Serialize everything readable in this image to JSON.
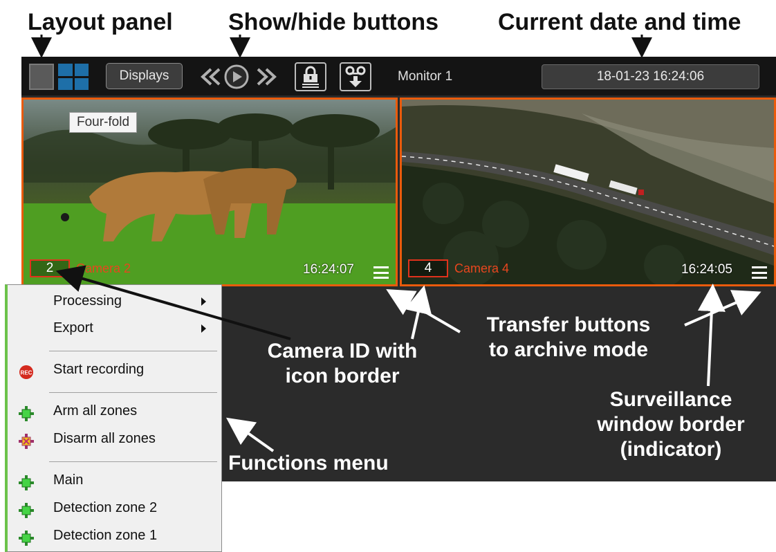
{
  "callouts": {
    "layout_panel": "Layout panel",
    "show_hide": "Show/hide buttons",
    "datetime": "Current date and time",
    "camera_id": [
      "Camera ID with",
      "icon border"
    ],
    "transfer": [
      "Transfer buttons",
      "to archive mode"
    ],
    "surveillance": [
      "Surveillance",
      "window border",
      "(indicator)"
    ],
    "functions_menu": "Functions menu"
  },
  "toolbar": {
    "displays_label": "Displays",
    "monitor_label": "Monitor 1",
    "datetime": "18-01-23 16:24:06"
  },
  "tiles": [
    {
      "id": "2",
      "name": "Camera 2",
      "time": "16:24:07",
      "tooltip": "Four-fold"
    },
    {
      "id": "4",
      "name": "Camera 4",
      "time": "16:24:05"
    }
  ],
  "menu": {
    "items": [
      {
        "label": "Processing",
        "icon": "none",
        "submenu": true
      },
      {
        "label": "Export",
        "icon": "none",
        "submenu": true
      },
      {
        "label": "Start recording",
        "icon": "rec-icon"
      },
      {
        "label": "Arm all zones",
        "icon": "zone-green-icon"
      },
      {
        "label": "Disarm all zones",
        "icon": "zone-yellow-icon"
      },
      {
        "label": "Main",
        "icon": "zone-green-icon"
      },
      {
        "label": "Detection zone 2",
        "icon": "zone-green-icon"
      },
      {
        "label": "Detection zone 1",
        "icon": "zone-green-icon"
      }
    ]
  },
  "colors": {
    "tile_border": "#ea5b0c",
    "camera_name": "#e8461e",
    "layout_active": "#1e6fa8",
    "menu_accent": "#6cc24a"
  }
}
